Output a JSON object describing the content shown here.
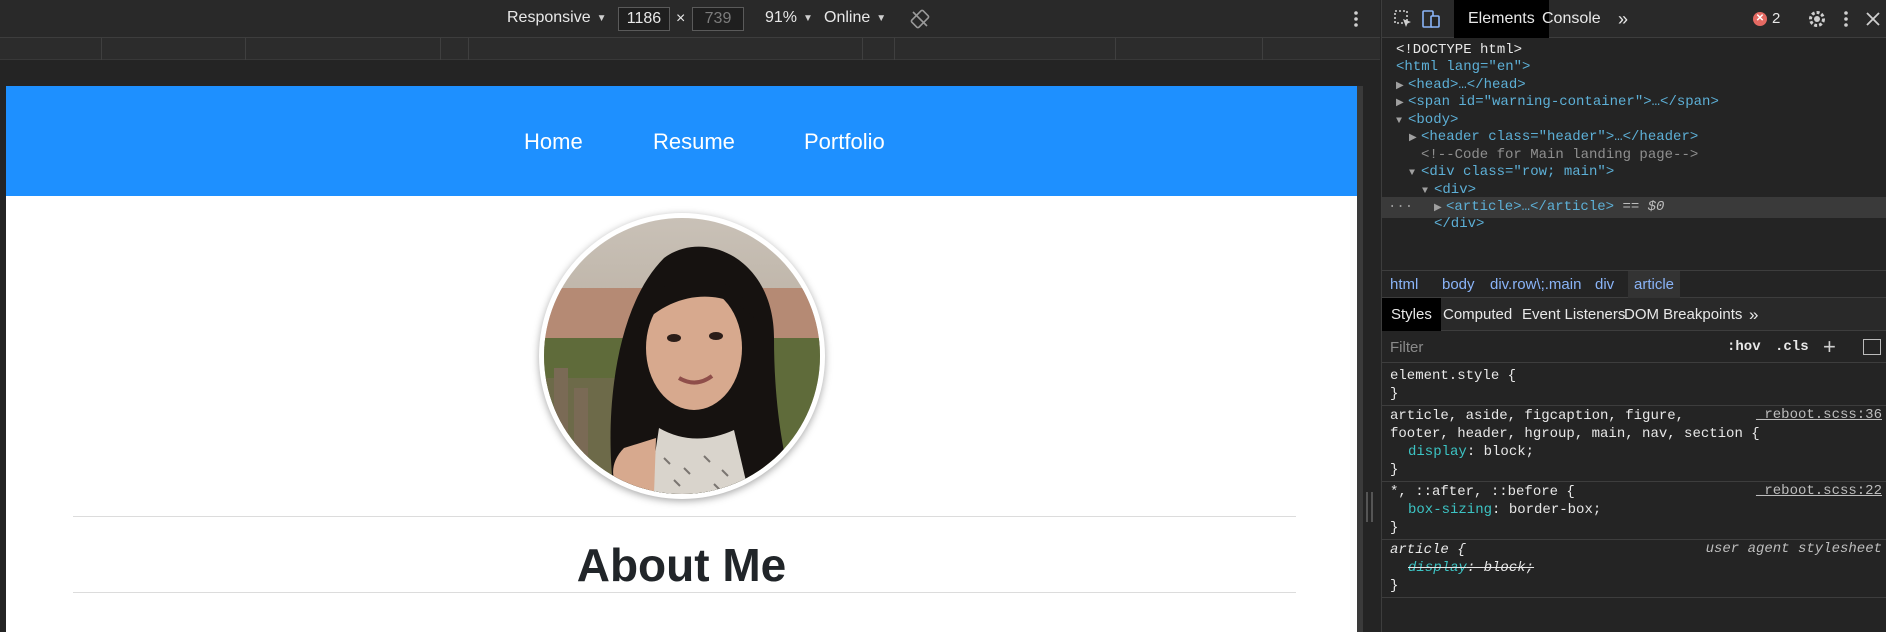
{
  "device_toolbar": {
    "device": "Responsive",
    "width": "1186",
    "times": "×",
    "height": "739",
    "zoom": "91%",
    "throttle": "Online"
  },
  "site": {
    "nav": [
      "Home",
      "Resume",
      "Portfolio"
    ],
    "heading": "About Me"
  },
  "devtools": {
    "tabs": [
      "Elements",
      "Console"
    ],
    "more": "»",
    "error_count": "2",
    "dom": [
      {
        "text": "<!DOCTYPE html>"
      },
      {
        "text": "<html lang=\"en\">"
      },
      {
        "text": "<head>…</head>"
      },
      {
        "text": "<span id=\"warning-container\">…</span>"
      },
      {
        "text": "<body>"
      },
      {
        "text": "<header class=\"header\">…</header>"
      },
      {
        "text": "<!--Code for Main landing page-->"
      },
      {
        "text": "<div class=\"row; main\">"
      },
      {
        "text": "<div>"
      },
      {
        "text": "<article>…</article>"
      },
      {
        "text": "== $0"
      },
      {
        "text": "</div>"
      }
    ],
    "breadcrumbs": [
      "html",
      "body",
      "div.row\\;.main",
      "div",
      "article"
    ],
    "sub_tabs": [
      "Styles",
      "Computed",
      "Event Listeners",
      "DOM Breakpoints"
    ],
    "filter_placeholder": "Filter",
    "hov": ":hov",
    "cls": ".cls",
    "rules": {
      "r1_selector": "element.style {",
      "r1_close": "}",
      "r2_sel_a": "article, aside, figcaption, figure,",
      "r2_sel_b": "footer, header, hgroup, main, nav, section {",
      "r2_source": "_reboot.scss:36",
      "r2_prop": "display",
      "r2_val": "block;",
      "r2_close": "}",
      "r3_selector": "*, ::after, ::before {",
      "r3_source": "_reboot.scss:22",
      "r3_prop": "box-sizing",
      "r3_val": "border-box;",
      "r3_close": "}",
      "r4_selector": "article {",
      "r4_source": "user agent stylesheet",
      "r4_prop": "display",
      "r4_val": "block;",
      "r4_close": "}"
    }
  },
  "colors": {
    "header_blue": "#1e90ff",
    "devtools_bg": "#242424"
  }
}
